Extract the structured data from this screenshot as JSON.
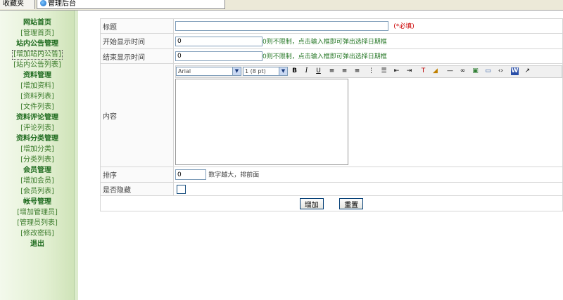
{
  "tabs": {
    "favorites": "收藏夹",
    "admin": "管理后台"
  },
  "sidebar": {
    "items": [
      {
        "label": "网站首页",
        "type": "h"
      },
      {
        "label": "[管理首页]",
        "type": "l"
      },
      {
        "label": "站内公告管理",
        "type": "h"
      },
      {
        "label": "[增加站内公告]",
        "type": "l",
        "active": true
      },
      {
        "label": "[站内公告列表]",
        "type": "l"
      },
      {
        "label": "资料管理",
        "type": "h"
      },
      {
        "label": "[增加资料]",
        "type": "l"
      },
      {
        "label": "[资料列表]",
        "type": "l"
      },
      {
        "label": "[文件列表]",
        "type": "l"
      },
      {
        "label": "资料评论管理",
        "type": "h"
      },
      {
        "label": "[评论列表]",
        "type": "l"
      },
      {
        "label": "资料分类管理",
        "type": "h"
      },
      {
        "label": "[增加分类]",
        "type": "l"
      },
      {
        "label": "[分类列表]",
        "type": "l"
      },
      {
        "label": "会员管理",
        "type": "h"
      },
      {
        "label": "[增加会员]",
        "type": "l"
      },
      {
        "label": "[会员列表]",
        "type": "l"
      },
      {
        "label": "帐号管理",
        "type": "h"
      },
      {
        "label": "[增加管理员]",
        "type": "l"
      },
      {
        "label": "[管理员列表]",
        "type": "l"
      },
      {
        "label": "[修改密码]",
        "type": "l"
      },
      {
        "label": "退出",
        "type": "h"
      }
    ]
  },
  "form": {
    "title_label": "标题",
    "title_value": "",
    "title_required": "(*必填)",
    "start_label": "开始显示时间",
    "start_value": "0",
    "start_hint": "0则不限制，点击输入框即可弹出选择日期框",
    "end_label": "结束显示时间",
    "end_value": "0",
    "end_hint": "0则不限制，点击输入框即可弹出选择日期框",
    "content_label": "内容",
    "editor": {
      "font": "Arial",
      "size": "1 (8 pt)"
    },
    "order_label": "排序",
    "order_value": "0",
    "order_hint": "数字越大，排前面",
    "hidden_label": "是否隐藏",
    "submit_label": "增加",
    "reset_label": "重置"
  }
}
